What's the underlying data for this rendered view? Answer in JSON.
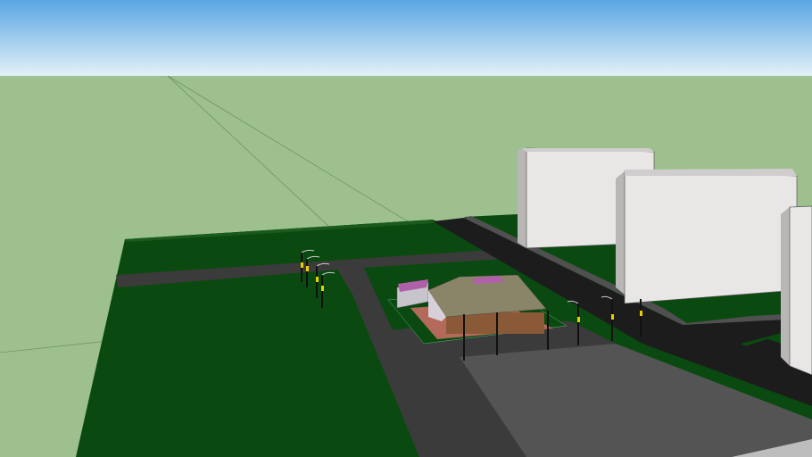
{
  "scene": {
    "type": "3d-model-viewport",
    "colors": {
      "sky_top": "#5aa6e3",
      "sky_horizon": "#e3f1f8",
      "ground": "#9dc08e",
      "grass_plate": "#0a4a10",
      "road": "#3b3b3b",
      "road_dark": "#1c1c1c",
      "plaza": "#545454",
      "building_front": "#e9e6e6",
      "building_side": "#b9b6b6",
      "roof": "#8a8468",
      "lamp_light": "#e8d000"
    }
  }
}
